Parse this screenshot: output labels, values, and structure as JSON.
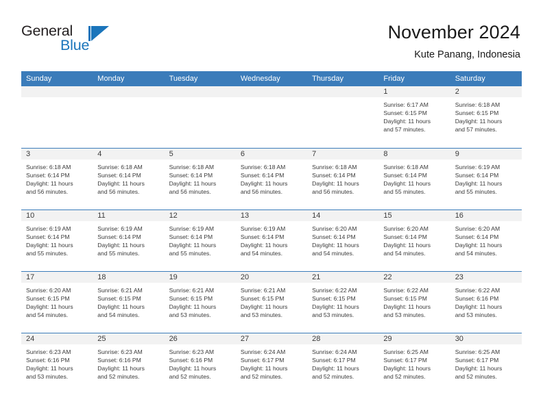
{
  "brand": {
    "name_part1": "General",
    "name_part2": "Blue",
    "logo_icon": "triangle-flag-mark",
    "accent_color": "#1b75bb"
  },
  "header": {
    "title": "November 2024",
    "subtitle": "Kute Panang, Indonesia"
  },
  "theme": {
    "header_blue": "#3b7cba",
    "daynum_band": "#f2f2f2",
    "text": "#3a3a3a"
  },
  "weekdays": [
    "Sunday",
    "Monday",
    "Tuesday",
    "Wednesday",
    "Thursday",
    "Friday",
    "Saturday"
  ],
  "labels": {
    "sunrise_prefix": "Sunrise:",
    "sunset_prefix": "Sunset:",
    "daylight_prefix": "Daylight:"
  },
  "weeks": [
    [
      {
        "day": "",
        "empty": true
      },
      {
        "day": "",
        "empty": true
      },
      {
        "day": "",
        "empty": true
      },
      {
        "day": "",
        "empty": true
      },
      {
        "day": "",
        "empty": true
      },
      {
        "day": "1",
        "sunrise": "Sunrise: 6:17 AM",
        "sunset": "Sunset: 6:15 PM",
        "daylight1": "Daylight: 11 hours",
        "daylight2": "and 57 minutes."
      },
      {
        "day": "2",
        "sunrise": "Sunrise: 6:18 AM",
        "sunset": "Sunset: 6:15 PM",
        "daylight1": "Daylight: 11 hours",
        "daylight2": "and 57 minutes."
      }
    ],
    [
      {
        "day": "3",
        "sunrise": "Sunrise: 6:18 AM",
        "sunset": "Sunset: 6:14 PM",
        "daylight1": "Daylight: 11 hours",
        "daylight2": "and 56 minutes."
      },
      {
        "day": "4",
        "sunrise": "Sunrise: 6:18 AM",
        "sunset": "Sunset: 6:14 PM",
        "daylight1": "Daylight: 11 hours",
        "daylight2": "and 56 minutes."
      },
      {
        "day": "5",
        "sunrise": "Sunrise: 6:18 AM",
        "sunset": "Sunset: 6:14 PM",
        "daylight1": "Daylight: 11 hours",
        "daylight2": "and 56 minutes."
      },
      {
        "day": "6",
        "sunrise": "Sunrise: 6:18 AM",
        "sunset": "Sunset: 6:14 PM",
        "daylight1": "Daylight: 11 hours",
        "daylight2": "and 56 minutes."
      },
      {
        "day": "7",
        "sunrise": "Sunrise: 6:18 AM",
        "sunset": "Sunset: 6:14 PM",
        "daylight1": "Daylight: 11 hours",
        "daylight2": "and 56 minutes."
      },
      {
        "day": "8",
        "sunrise": "Sunrise: 6:18 AM",
        "sunset": "Sunset: 6:14 PM",
        "daylight1": "Daylight: 11 hours",
        "daylight2": "and 55 minutes."
      },
      {
        "day": "9",
        "sunrise": "Sunrise: 6:19 AM",
        "sunset": "Sunset: 6:14 PM",
        "daylight1": "Daylight: 11 hours",
        "daylight2": "and 55 minutes."
      }
    ],
    [
      {
        "day": "10",
        "sunrise": "Sunrise: 6:19 AM",
        "sunset": "Sunset: 6:14 PM",
        "daylight1": "Daylight: 11 hours",
        "daylight2": "and 55 minutes."
      },
      {
        "day": "11",
        "sunrise": "Sunrise: 6:19 AM",
        "sunset": "Sunset: 6:14 PM",
        "daylight1": "Daylight: 11 hours",
        "daylight2": "and 55 minutes."
      },
      {
        "day": "12",
        "sunrise": "Sunrise: 6:19 AM",
        "sunset": "Sunset: 6:14 PM",
        "daylight1": "Daylight: 11 hours",
        "daylight2": "and 55 minutes."
      },
      {
        "day": "13",
        "sunrise": "Sunrise: 6:19 AM",
        "sunset": "Sunset: 6:14 PM",
        "daylight1": "Daylight: 11 hours",
        "daylight2": "and 54 minutes."
      },
      {
        "day": "14",
        "sunrise": "Sunrise: 6:20 AM",
        "sunset": "Sunset: 6:14 PM",
        "daylight1": "Daylight: 11 hours",
        "daylight2": "and 54 minutes."
      },
      {
        "day": "15",
        "sunrise": "Sunrise: 6:20 AM",
        "sunset": "Sunset: 6:14 PM",
        "daylight1": "Daylight: 11 hours",
        "daylight2": "and 54 minutes."
      },
      {
        "day": "16",
        "sunrise": "Sunrise: 6:20 AM",
        "sunset": "Sunset: 6:14 PM",
        "daylight1": "Daylight: 11 hours",
        "daylight2": "and 54 minutes."
      }
    ],
    [
      {
        "day": "17",
        "sunrise": "Sunrise: 6:20 AM",
        "sunset": "Sunset: 6:15 PM",
        "daylight1": "Daylight: 11 hours",
        "daylight2": "and 54 minutes."
      },
      {
        "day": "18",
        "sunrise": "Sunrise: 6:21 AM",
        "sunset": "Sunset: 6:15 PM",
        "daylight1": "Daylight: 11 hours",
        "daylight2": "and 54 minutes."
      },
      {
        "day": "19",
        "sunrise": "Sunrise: 6:21 AM",
        "sunset": "Sunset: 6:15 PM",
        "daylight1": "Daylight: 11 hours",
        "daylight2": "and 53 minutes."
      },
      {
        "day": "20",
        "sunrise": "Sunrise: 6:21 AM",
        "sunset": "Sunset: 6:15 PM",
        "daylight1": "Daylight: 11 hours",
        "daylight2": "and 53 minutes."
      },
      {
        "day": "21",
        "sunrise": "Sunrise: 6:22 AM",
        "sunset": "Sunset: 6:15 PM",
        "daylight1": "Daylight: 11 hours",
        "daylight2": "and 53 minutes."
      },
      {
        "day": "22",
        "sunrise": "Sunrise: 6:22 AM",
        "sunset": "Sunset: 6:15 PM",
        "daylight1": "Daylight: 11 hours",
        "daylight2": "and 53 minutes."
      },
      {
        "day": "23",
        "sunrise": "Sunrise: 6:22 AM",
        "sunset": "Sunset: 6:16 PM",
        "daylight1": "Daylight: 11 hours",
        "daylight2": "and 53 minutes."
      }
    ],
    [
      {
        "day": "24",
        "sunrise": "Sunrise: 6:23 AM",
        "sunset": "Sunset: 6:16 PM",
        "daylight1": "Daylight: 11 hours",
        "daylight2": "and 53 minutes."
      },
      {
        "day": "25",
        "sunrise": "Sunrise: 6:23 AM",
        "sunset": "Sunset: 6:16 PM",
        "daylight1": "Daylight: 11 hours",
        "daylight2": "and 52 minutes."
      },
      {
        "day": "26",
        "sunrise": "Sunrise: 6:23 AM",
        "sunset": "Sunset: 6:16 PM",
        "daylight1": "Daylight: 11 hours",
        "daylight2": "and 52 minutes."
      },
      {
        "day": "27",
        "sunrise": "Sunrise: 6:24 AM",
        "sunset": "Sunset: 6:17 PM",
        "daylight1": "Daylight: 11 hours",
        "daylight2": "and 52 minutes."
      },
      {
        "day": "28",
        "sunrise": "Sunrise: 6:24 AM",
        "sunset": "Sunset: 6:17 PM",
        "daylight1": "Daylight: 11 hours",
        "daylight2": "and 52 minutes."
      },
      {
        "day": "29",
        "sunrise": "Sunrise: 6:25 AM",
        "sunset": "Sunset: 6:17 PM",
        "daylight1": "Daylight: 11 hours",
        "daylight2": "and 52 minutes."
      },
      {
        "day": "30",
        "sunrise": "Sunrise: 6:25 AM",
        "sunset": "Sunset: 6:17 PM",
        "daylight1": "Daylight: 11 hours",
        "daylight2": "and 52 minutes."
      }
    ]
  ]
}
